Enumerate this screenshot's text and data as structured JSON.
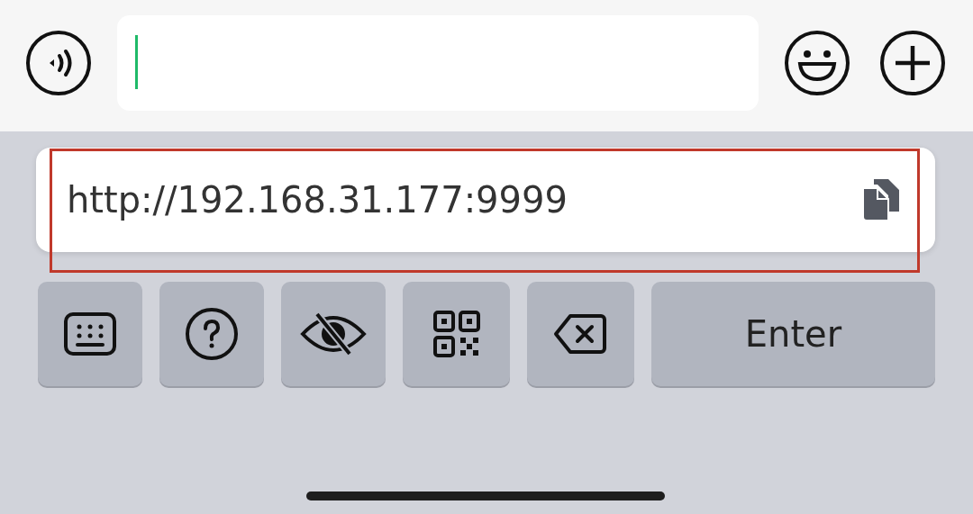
{
  "input_bar": {
    "focused": true
  },
  "suggestion": {
    "text": "http://192.168.31.177:9999",
    "highlighted": true
  },
  "keys": [
    {
      "kind": "icon"
    },
    {
      "kind": "icon"
    },
    {
      "kind": "icon"
    },
    {
      "kind": "icon"
    },
    {
      "kind": "icon"
    },
    {
      "kind": "text",
      "label": "Enter"
    }
  ]
}
